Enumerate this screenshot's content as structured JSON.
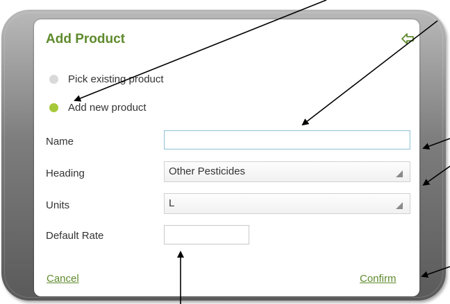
{
  "dialog": {
    "title": "Add Product",
    "back_icon": "back-arrow-icon"
  },
  "mode_options": [
    {
      "label": "Pick existing product",
      "selected": false
    },
    {
      "label": "Add new product",
      "selected": true
    }
  ],
  "form": {
    "name_label": "Name",
    "name_value": "",
    "heading_label": "Heading",
    "heading_value": "Other Pesticides",
    "units_label": "Units",
    "units_value": "L",
    "default_rate_label": "Default Rate",
    "default_rate_value": ""
  },
  "actions": {
    "cancel_label": "Cancel",
    "confirm_label": "Confirm"
  },
  "colors": {
    "accent": "#5e8a2c",
    "radio_selected": "#a6c93a",
    "radio_unselected": "#d9d9d9",
    "shell": "#7d7d7d"
  }
}
